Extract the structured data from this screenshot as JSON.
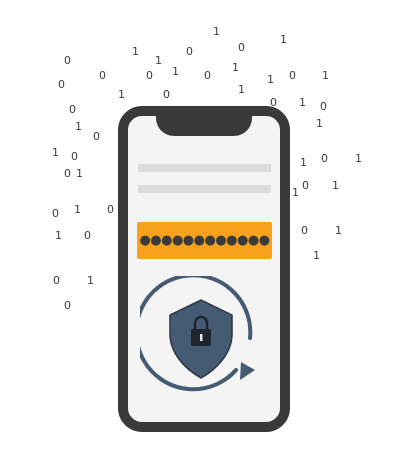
{
  "digits": [
    "1",
    "0",
    "1",
    "1",
    "0",
    "0",
    "1",
    "0",
    "0",
    "1",
    "0",
    "0",
    "1",
    "1",
    "0",
    "1",
    "0",
    "1",
    "1",
    "0",
    "1",
    "0",
    "1",
    "0",
    "1",
    "0",
    "1",
    "0",
    "0",
    "1",
    "1",
    "0",
    "1",
    "0",
    "1",
    "1",
    "0",
    "1",
    "0",
    "1",
    "0",
    "0",
    "1",
    "1",
    "0",
    "1",
    "0",
    "1",
    "0",
    "1",
    "1"
  ],
  "password": {
    "masked": "●●●●●●●●●●●●"
  },
  "colors": {
    "phone_frame": "#3a3a3a",
    "screen": "#f4f4f4",
    "password_field": "#f7a11d",
    "shield": "#455a73",
    "placeholder_lines": "#dcdcdc"
  },
  "icons": {
    "shield": "shield-lock-icon",
    "refresh": "circular-arrow-icon"
  }
}
